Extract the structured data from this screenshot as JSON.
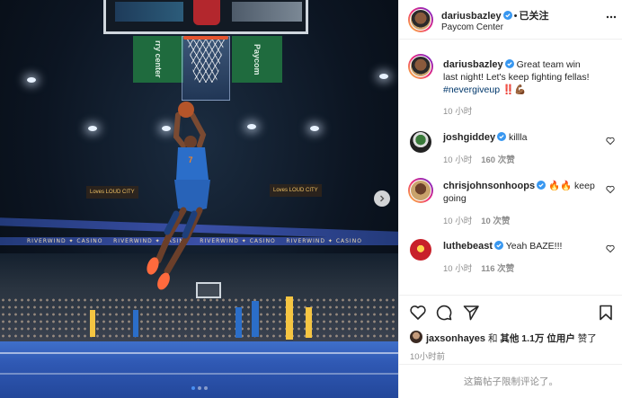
{
  "post": {
    "author": "dariusbazley",
    "follow_status": "已关注",
    "location": "Paycom Center",
    "image_alt": "",
    "carousel": {
      "count": 3,
      "active": 0
    }
  },
  "caption": {
    "username": "dariusbazley",
    "text": "Great team win last night! Let's keep fighting fellas! ",
    "hashtag": "#nevergiveup",
    "suffix": " ‼️💪🏾",
    "time": "10 小时"
  },
  "comments": [
    {
      "username": "joshgiddey",
      "text": "killla",
      "time": "10 小时",
      "likes": "160 次赞"
    },
    {
      "username": "chrisjohnsonhoops",
      "text": "🔥🔥 keep going",
      "time": "10 小时",
      "likes": "10 次赞"
    },
    {
      "username": "luthebeast",
      "text": "Yeah BAZE!!!",
      "time": "10 小时",
      "likes": "116 次赞"
    }
  ],
  "likes": {
    "first_user": "jaxsonhayes",
    "and": " 和 ",
    "others": "其他 1.1万 位用户",
    "suffix": " 赞了"
  },
  "timestamp": "10小时前",
  "comments_restricted": "这篇帖子限制评论了。",
  "photo_signs": {
    "banner": "RIVERWIND ✦ CASINO",
    "sign_left": "Loves  LOUD CITY",
    "sign_right": "Loves  LOUD CITY",
    "center_sign": "rry center",
    "paycom_sign": "Paycom"
  },
  "colors": {
    "verified": "#3897f0",
    "secondary_text": "#8e8e8e",
    "hashtag": "#00376b",
    "jersey": "#2b6ec9",
    "jersey_accent": "#f58426"
  }
}
